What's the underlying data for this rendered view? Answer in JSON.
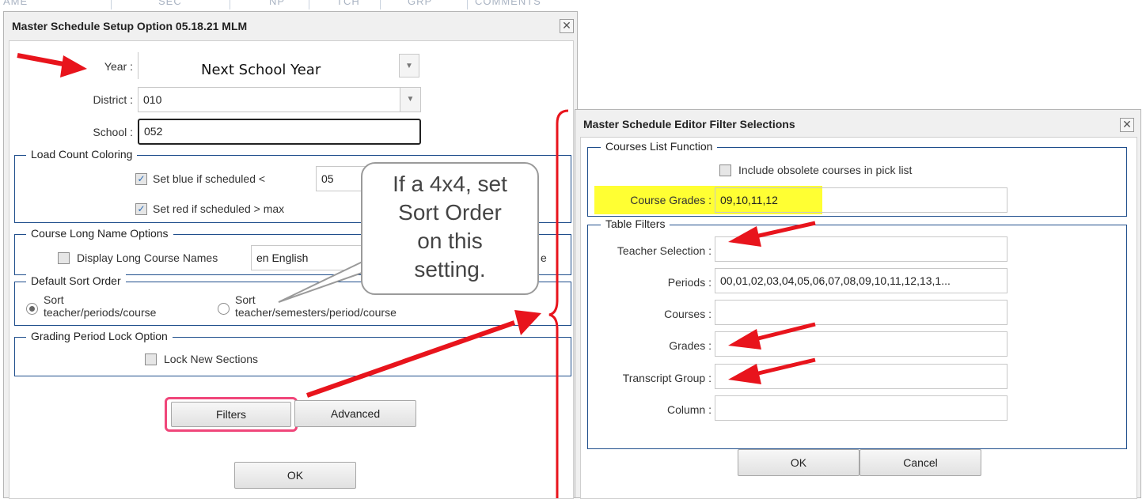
{
  "bg_header": [
    "AME",
    "SEC",
    "NP",
    "TCH",
    "GRP",
    "COMMENTS"
  ],
  "setup_dialog": {
    "title": "Master Schedule Setup Option 05.18.21 MLM",
    "year_label": "Year :",
    "year_value": "Next School Year",
    "district_label": "District :",
    "district_value": "010",
    "school_label": "School :",
    "school_value": "052",
    "load_count": {
      "legend": "Load Count Coloring",
      "blue_label": "Set blue if scheduled <",
      "blue_value": "05",
      "red_label": "Set red if scheduled > max"
    },
    "long_name": {
      "legend": "Course Long Name Options",
      "checkbox_label": "Display Long Course Names",
      "language_value": "en English",
      "trailing_text": "e"
    },
    "sort_order": {
      "legend": "Default Sort Order",
      "option1_line1": "Sort",
      "option1_line2": "teacher/periods/course",
      "option2_line1": "Sort",
      "option2_line2": "teacher/semesters/period/course"
    },
    "lock": {
      "legend": "Grading Period Lock Option",
      "checkbox_label": "Lock New Sections"
    },
    "filters_button": "Filters",
    "advanced_button": "Advanced",
    "ok_button": "OK"
  },
  "callout": {
    "line1": "If a 4x4, set",
    "line2": "Sort Order",
    "line3": "on this",
    "line4": "setting."
  },
  "filter_dialog": {
    "title": "Master Schedule Editor Filter Selections",
    "courses_list": {
      "legend": "Courses List Function",
      "obsolete_label": "Include obsolete courses in pick list",
      "grades_label": "Course Grades :",
      "grades_value": "09,10,11,12"
    },
    "table_filters": {
      "legend": "Table Filters",
      "rows": [
        {
          "label": "Teacher Selection :",
          "value": ""
        },
        {
          "label": "Periods :",
          "value": "00,01,02,03,04,05,06,07,08,09,10,11,12,13,1..."
        },
        {
          "label": "Courses :",
          "value": ""
        },
        {
          "label": "Grades :",
          "value": ""
        },
        {
          "label": "Transcript Group :",
          "value": ""
        },
        {
          "label": "Column :",
          "value": ""
        }
      ]
    },
    "ok_button": "OK",
    "cancel_button": "Cancel"
  },
  "colors": {
    "annotation_red": "#e8141c",
    "highlight_yellow": "#ffff33",
    "button_outline_pink": "#f0467a",
    "fieldset_border": "#1f4e8c"
  }
}
